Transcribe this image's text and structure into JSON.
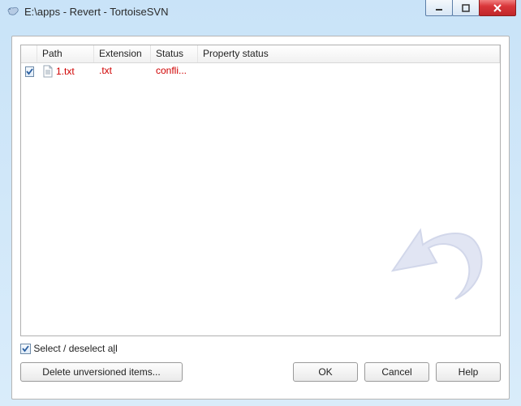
{
  "titlebar": {
    "title": "E:\\apps - Revert - TortoiseSVN"
  },
  "filelist": {
    "headers": {
      "path": "Path",
      "extension": "Extension",
      "status": "Status",
      "property_status": "Property status"
    },
    "rows": [
      {
        "checked": true,
        "filename": "1.txt",
        "extension": ".txt",
        "status": "confli...",
        "property_status": ""
      }
    ]
  },
  "select_all": {
    "checked": true,
    "label_pre": "Select / deselect a",
    "label_ul": "l",
    "label_post": "l"
  },
  "buttons": {
    "delete_unversioned": "Delete unversioned items...",
    "ok": "OK",
    "cancel": "Cancel",
    "help": "Help"
  },
  "colors": {
    "conflict_text": "#d00000"
  }
}
